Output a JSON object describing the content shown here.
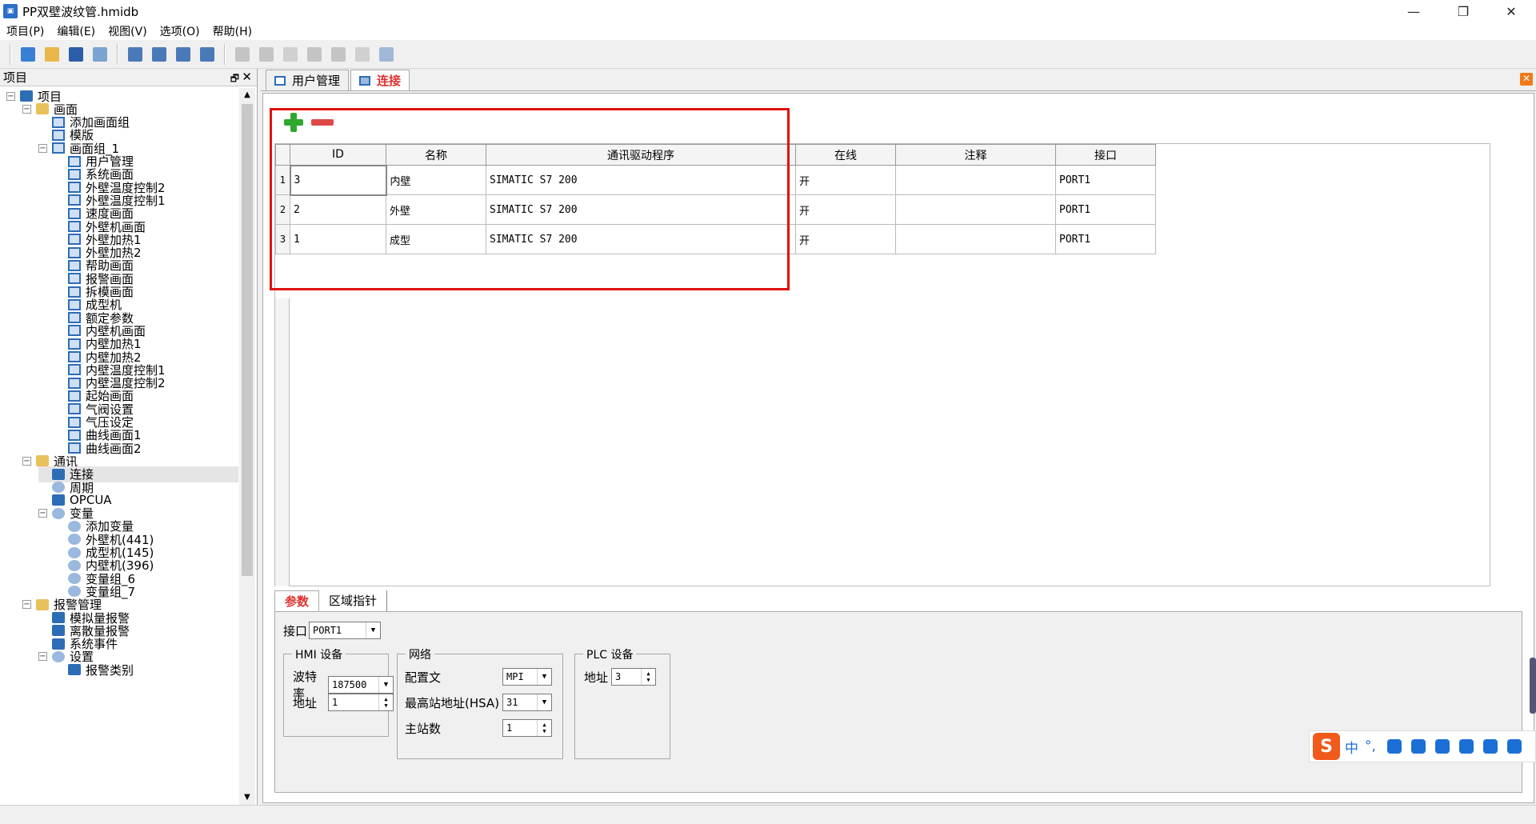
{
  "window": {
    "title": "PP双壁波纹管.hmidb"
  },
  "menu": [
    "项目(P)",
    "编辑(E)",
    "视图(V)",
    "选项(O)",
    "帮助(H)"
  ],
  "left_panel": {
    "title": "项目"
  },
  "tree": [
    {
      "label": "项目",
      "level": 0,
      "icon": "project-icon",
      "exp": "−"
    },
    {
      "label": "画面",
      "level": 1,
      "icon": "folder-icon",
      "exp": "−"
    },
    {
      "label": "添加画面组",
      "level": 2,
      "icon": "add-screen-group-icon"
    },
    {
      "label": "模版",
      "level": 2,
      "icon": "template-icon"
    },
    {
      "label": "画面组_1",
      "level": 2,
      "icon": "screen-group-icon",
      "exp": "−"
    },
    {
      "label": "用户管理",
      "level": 3,
      "icon": "screen-icon"
    },
    {
      "label": "系统画面",
      "level": 3,
      "icon": "screen-icon"
    },
    {
      "label": "外壁温度控制2",
      "level": 3,
      "icon": "screen-icon"
    },
    {
      "label": "外壁温度控制1",
      "level": 3,
      "icon": "screen-icon"
    },
    {
      "label": "速度画面",
      "level": 3,
      "icon": "screen-icon"
    },
    {
      "label": "外壁机画面",
      "level": 3,
      "icon": "screen-icon"
    },
    {
      "label": "外壁加热1",
      "level": 3,
      "icon": "screen-icon"
    },
    {
      "label": "外壁加热2",
      "level": 3,
      "icon": "screen-icon"
    },
    {
      "label": "帮助画面",
      "level": 3,
      "icon": "screen-icon"
    },
    {
      "label": "报警画面",
      "level": 3,
      "icon": "screen-icon"
    },
    {
      "label": "拆模画面",
      "level": 3,
      "icon": "screen-icon"
    },
    {
      "label": "成型机",
      "level": 3,
      "icon": "screen-icon"
    },
    {
      "label": "额定参数",
      "level": 3,
      "icon": "screen-icon"
    },
    {
      "label": "内壁机画面",
      "level": 3,
      "icon": "screen-icon"
    },
    {
      "label": "内壁加热1",
      "level": 3,
      "icon": "screen-icon"
    },
    {
      "label": "内壁加热2",
      "level": 3,
      "icon": "screen-icon"
    },
    {
      "label": "内壁温度控制1",
      "level": 3,
      "icon": "screen-icon"
    },
    {
      "label": "内壁温度控制2",
      "level": 3,
      "icon": "screen-icon"
    },
    {
      "label": "起始画面",
      "level": 3,
      "icon": "screen-icon"
    },
    {
      "label": "气阀设置",
      "level": 3,
      "icon": "screen-icon"
    },
    {
      "label": "气压设定",
      "level": 3,
      "icon": "screen-icon"
    },
    {
      "label": "曲线画面1",
      "level": 3,
      "icon": "screen-icon"
    },
    {
      "label": "曲线画面2",
      "level": 3,
      "icon": "screen-icon"
    },
    {
      "label": "通讯",
      "level": 1,
      "icon": "folder-icon",
      "exp": "−"
    },
    {
      "label": "连接",
      "level": 2,
      "icon": "connection-icon",
      "selected": true
    },
    {
      "label": "周期",
      "level": 2,
      "icon": "cycle-icon"
    },
    {
      "label": "OPCUA",
      "level": 2,
      "icon": "opcua-icon"
    },
    {
      "label": "变量",
      "level": 2,
      "icon": "variable-folder-icon",
      "exp": "−"
    },
    {
      "label": "添加变量",
      "level": 3,
      "icon": "variable-icon"
    },
    {
      "label": "外壁机(441)",
      "level": 3,
      "icon": "variable-icon"
    },
    {
      "label": "成型机(145)",
      "level": 3,
      "icon": "variable-icon"
    },
    {
      "label": "内壁机(396)",
      "level": 3,
      "icon": "variable-icon"
    },
    {
      "label": "变量组_6",
      "level": 3,
      "icon": "variable-icon"
    },
    {
      "label": "变量组_7",
      "level": 3,
      "icon": "variable-icon"
    },
    {
      "label": "报警管理",
      "level": 1,
      "icon": "alarm-folder-icon",
      "exp": "−"
    },
    {
      "label": "模拟量报警",
      "level": 2,
      "icon": "alarm-icon"
    },
    {
      "label": "离散量报警",
      "level": 2,
      "icon": "alarm-icon"
    },
    {
      "label": "系统事件",
      "level": 2,
      "icon": "event-icon"
    },
    {
      "label": "设置",
      "level": 2,
      "icon": "settings-icon",
      "exp": "−"
    },
    {
      "label": "报警类别",
      "level": 3,
      "icon": "alarm-class-icon"
    }
  ],
  "tabs": [
    {
      "label": "用户管理",
      "active": false
    },
    {
      "label": "连接",
      "active": true
    }
  ],
  "table": {
    "headers": [
      "ID",
      "名称",
      "通讯驱动程序",
      "在线",
      "注释",
      "接口"
    ],
    "rows": [
      {
        "n": "1",
        "id": "3",
        "name": "内壁",
        "driver": "SIMATIC S7 200",
        "online": "开",
        "comment": "",
        "port": "PORT1"
      },
      {
        "n": "2",
        "id": "2",
        "name": "外壁",
        "driver": "SIMATIC S7 200",
        "online": "开",
        "comment": "",
        "port": "PORT1"
      },
      {
        "n": "3",
        "id": "1",
        "name": "成型",
        "driver": "SIMATIC S7 200",
        "online": "开",
        "comment": "",
        "port": "PORT1"
      }
    ]
  },
  "bottom_tabs": [
    {
      "label": "参数",
      "active": true
    },
    {
      "label": "区域指针",
      "active": false
    }
  ],
  "params": {
    "port_label": "接口",
    "port_value": "PORT1",
    "hmi": {
      "title": "HMI 设备",
      "baud_label": "波特率",
      "baud_value": "187500",
      "addr_label": "地址",
      "addr_value": "1"
    },
    "network": {
      "title": "网络",
      "profile_label": "配置文",
      "profile_value": "MPI",
      "hsa_label": "最高站地址(HSA)",
      "hsa_value": "31",
      "master_label": "主站数",
      "master_value": "1"
    },
    "plc": {
      "title": "PLC 设备",
      "addr_label": "地址",
      "addr_value": "3"
    }
  },
  "ime": {
    "logo": "S",
    "lang": "中",
    "punct": "°,"
  },
  "colors": {
    "accent_red": "#e01010",
    "tab_active": "#e03030"
  }
}
